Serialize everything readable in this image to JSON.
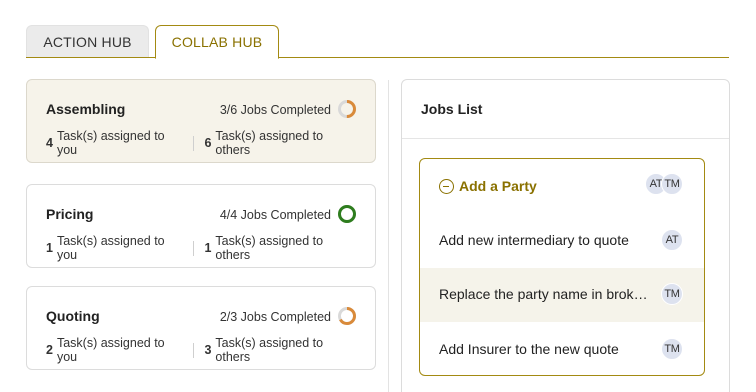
{
  "tabs": {
    "action": "ACTION HUB",
    "collab": "COLLAB HUB"
  },
  "stages": [
    {
      "title": "Assembling",
      "completed": 3,
      "total": 6,
      "progress_text": "3/6 Jobs Completed",
      "you_count": "4",
      "you_label": "Task(s) assigned to you",
      "others_count": "6",
      "others_label": "Task(s) assigned to others",
      "ring_color": "#d98a3a"
    },
    {
      "title": "Pricing",
      "completed": 4,
      "total": 4,
      "progress_text": "4/4 Jobs Completed",
      "you_count": "1",
      "you_label": "Task(s) assigned to you",
      "others_count": "1",
      "others_label": "Task(s) assigned to others",
      "ring_color": "#2e7d1e"
    },
    {
      "title": "Quoting",
      "completed": 2,
      "total": 3,
      "progress_text": "2/3 Jobs Completed",
      "you_count": "2",
      "you_label": "Task(s) assigned to you",
      "others_count": "3",
      "others_label": "Task(s) assigned to others",
      "ring_color": "#d98a3a"
    }
  ],
  "jobs": {
    "header": "Jobs List",
    "group": {
      "title": "Add a Party",
      "avatars": [
        "AT",
        "TM"
      ]
    },
    "items": [
      {
        "text": "Add new intermediary to quote",
        "avatar": "AT"
      },
      {
        "text": "Replace the party name in broker account",
        "avatar": "TM"
      },
      {
        "text": "Add Insurer to the new quote",
        "avatar": "TM"
      }
    ]
  },
  "colors": {
    "accent": "#8a7100",
    "accent_border": "#a38a12",
    "ring_track": "#d9d9d9"
  }
}
